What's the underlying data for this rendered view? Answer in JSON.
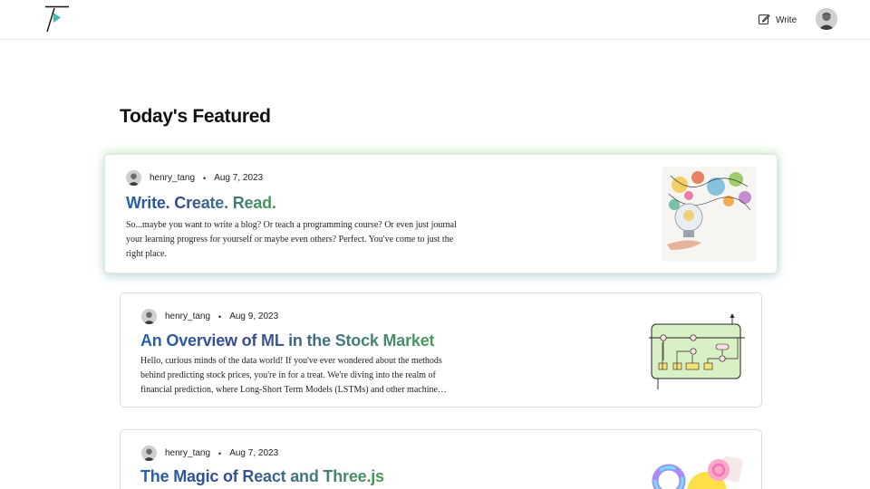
{
  "header": {
    "write_label": "Write"
  },
  "icons": {
    "logo": "t-logo-icon",
    "write": "pencil-square-icon",
    "avatar": "user-avatar"
  },
  "page": {
    "section_title": "Today's Featured"
  },
  "posts": [
    {
      "author": "henry_tang",
      "separator": "•",
      "date": "Aug 7, 2023",
      "title": "Write. Create. Read.",
      "excerpt": "So...maybe you want to write a blog? Or teach a programming course? Or even just journal your learning progress for yourself or maybe even others? Perfect. You've come to just the right place.",
      "thumbnail": "lightbulb-illustration"
    },
    {
      "author": "henry_tang",
      "separator": "•",
      "date": "Aug 9, 2023",
      "title": "An Overview of ML in the Stock Market",
      "excerpt": "Hello, curious minds of the data world! If you've ever wondered about the methods behind predicting stock prices, you're in for a treat. We're diving into the realm of financial prediction, where Long-Short Term Models (LSTMs) and other machine…",
      "thumbnail": "lstm-diagram"
    },
    {
      "author": "henry_tang",
      "separator": "•",
      "date": "Aug 7, 2023",
      "title": "The Magic of React and Three.js",
      "excerpt": "",
      "thumbnail": "3d-shapes-illustration"
    }
  ],
  "colors": {
    "title_gradient_start": "#2563a8",
    "title_gradient_end": "#4a9b56",
    "featured_glow_green": "#96dc78",
    "featured_glow_blue": "#78aadc",
    "border": "#dcdcdc"
  }
}
